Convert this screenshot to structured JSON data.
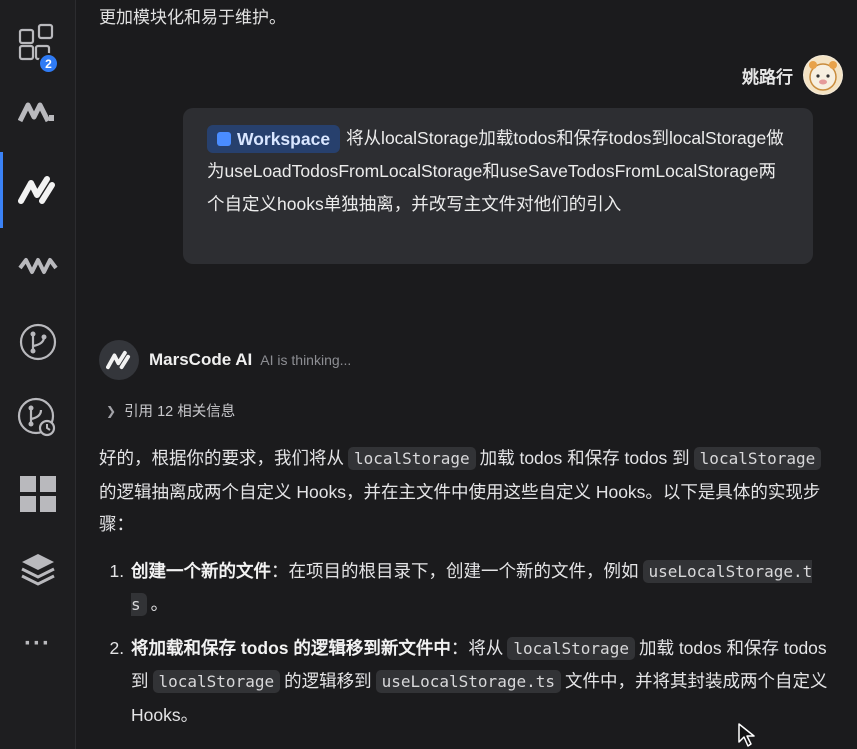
{
  "activity_bar": {
    "items": [
      {
        "name": "extensions-icon",
        "badge": "2"
      },
      {
        "name": "marscode-alt-icon"
      },
      {
        "name": "marscode-icon",
        "active": true
      },
      {
        "name": "wave-icon"
      },
      {
        "name": "source-control-icon"
      },
      {
        "name": "git-graph-icon"
      },
      {
        "name": "grid-icon"
      },
      {
        "name": "layers-icon"
      },
      {
        "name": "more-icon",
        "glyph": "···"
      }
    ],
    "accent": "#3b82f6"
  },
  "chat": {
    "previous_text": "更加模块化和易于维护。",
    "user": {
      "name": "姚路行",
      "workspace_chip": "Workspace",
      "message": "将从localStorage加载todos和保存todos到localStorage做为useLoadTodosFromLocalStorage和useSaveTodosFromLocalStorage两个自定义hooks单独抽离，并改写主文件对他们的引入"
    },
    "ai": {
      "name": "MarsCode AI",
      "status": "AI is thinking...",
      "reference": "引用 12 相关信息",
      "intro": {
        "p1": "好的，根据你的要求，我们将从",
        "c1": "localStorage",
        "p2": "加载 todos 和保存 todos 到",
        "c2": "localStorage",
        "p3": "的逻辑抽离成两个自定义 Hooks，并在主文件中使用这些自定义 Hooks。以下是具体的实现步骤："
      },
      "steps": [
        {
          "title": "创建一个新的文件",
          "t1": "：在项目的根目录下，创建一个新的文件，例如",
          "c1": "useLocalStorage.ts",
          "t2": "。"
        },
        {
          "title": "将加载和保存 todos 的逻辑移到新文件中",
          "t1": "：将从",
          "c1": "localStorage",
          "t2": "加载 todos 和保存 todos 到",
          "c2": "localStorage",
          "t3": "的逻辑移到",
          "c3": "useLocalStorage.ts",
          "t4": "文件中，并将其封装成两个自定义 Hooks。"
        }
      ]
    }
  }
}
